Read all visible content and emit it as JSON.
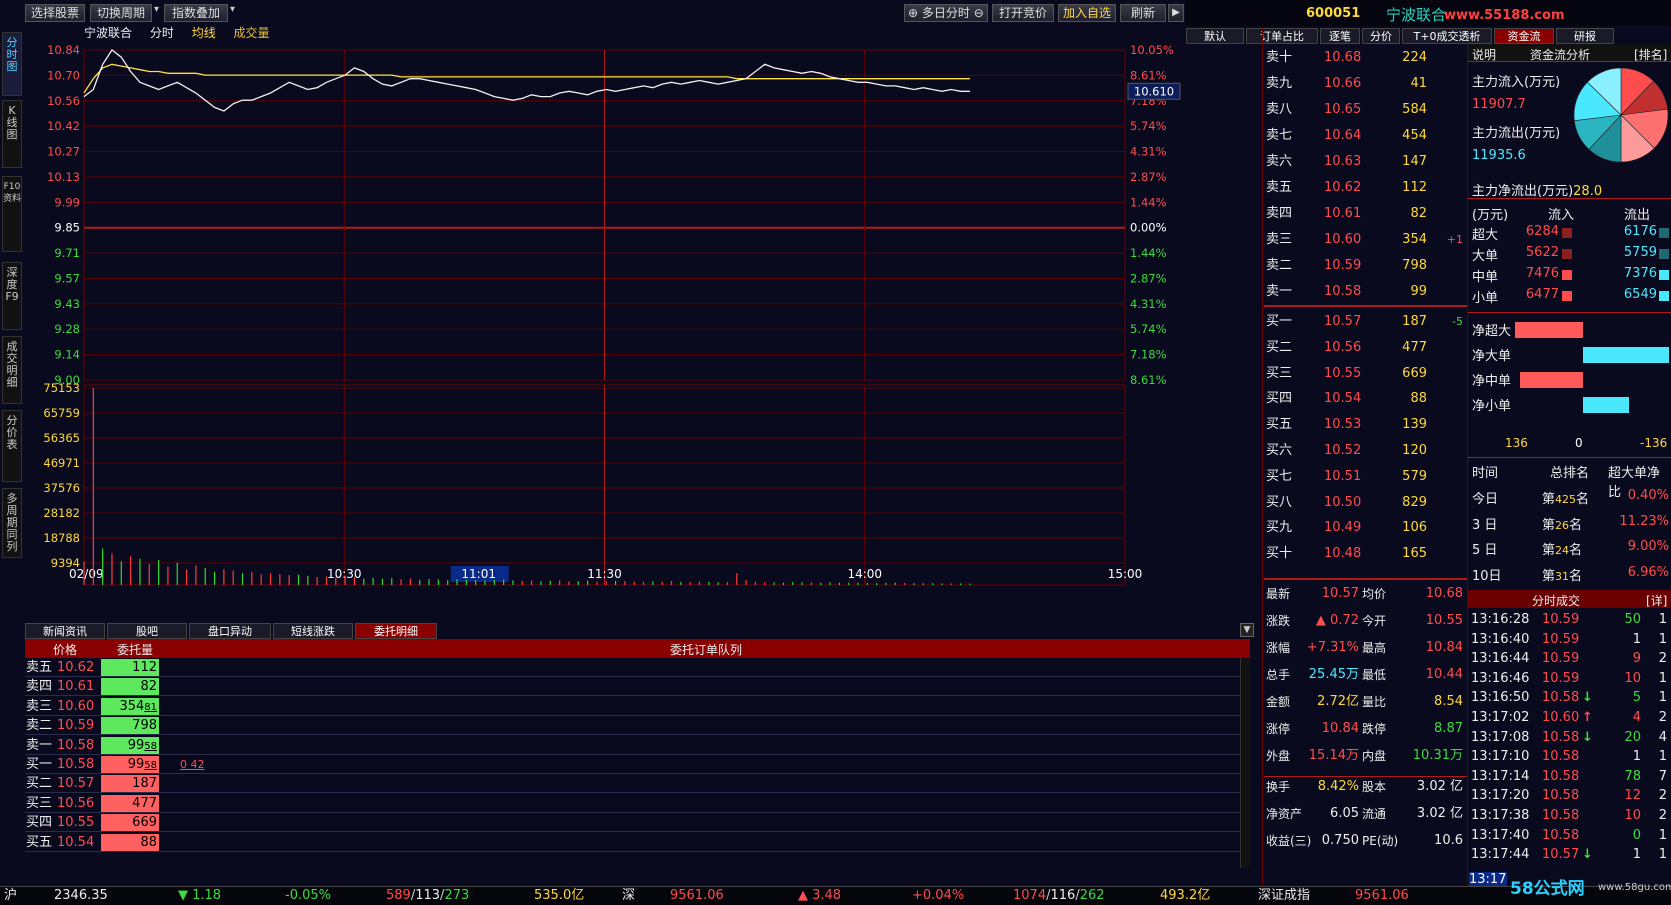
{
  "toolbar": {
    "select_stock": "选择股票",
    "switch_period": "切换周期",
    "index_overlay": "指数叠加",
    "multi_day": "多日分时",
    "open_auction": "打开竞价",
    "add_watch": "加入自选",
    "refresh": "刷新"
  },
  "stock": {
    "code": "600051",
    "name": "宁波联合",
    "watermark": "www.55188.com"
  },
  "side_tabs": [
    "分时图",
    "K线图",
    "F10资料",
    "深度F9",
    "成交明细",
    "分价表",
    "多周期同列"
  ],
  "chart_header": {
    "name": "宁波联合",
    "fenshi": "分时",
    "avg": "均线",
    "vol": "成交量"
  },
  "chart_data": {
    "type": "line",
    "price_ticks": [
      "10.84",
      "10.70",
      "10.56",
      "10.42",
      "10.27",
      "10.13",
      "9.99",
      "9.85",
      "9.71",
      "9.57",
      "9.43",
      "9.28",
      "9.14",
      "9.00"
    ],
    "pct_ticks": [
      "10.05%",
      "8.61%",
      "7.18%",
      "5.74%",
      "4.31%",
      "2.87%",
      "1.44%",
      "0.00%",
      "1.44%",
      "2.87%",
      "4.31%",
      "5.74%",
      "7.18%",
      "8.61%"
    ],
    "current_tag": "10.610",
    "prev_close": 9.85,
    "ylim": [
      9.0,
      10.84
    ],
    "time_labels": [
      "02/09",
      "10:30",
      "11:01",
      "11:30",
      "14:00",
      "15:00"
    ],
    "vol_ticks": [
      "75153",
      "65759",
      "56365",
      "46971",
      "37576",
      "28182",
      "18788",
      "9394"
    ],
    "vol_max": 75153,
    "price_series": [
      10.58,
      10.62,
      10.76,
      10.84,
      10.8,
      10.72,
      10.66,
      10.64,
      10.62,
      10.64,
      10.66,
      10.63,
      10.6,
      10.56,
      10.52,
      10.5,
      10.54,
      10.56,
      10.56,
      10.58,
      10.6,
      10.63,
      10.66,
      10.64,
      10.62,
      10.63,
      10.66,
      10.68,
      10.7,
      10.74,
      10.72,
      10.68,
      10.65,
      10.64,
      10.66,
      10.68,
      10.68,
      10.67,
      10.66,
      10.65,
      10.64,
      10.63,
      10.62,
      10.6,
      10.58,
      10.57,
      10.56,
      10.57,
      10.59,
      10.58,
      10.58,
      10.6,
      10.61,
      10.6,
      10.59,
      10.61,
      10.62,
      10.61,
      10.62,
      10.63,
      10.64,
      10.63,
      10.65,
      10.66,
      10.65,
      10.66,
      10.67,
      10.66,
      10.65,
      10.66,
      10.67,
      10.68,
      10.72,
      10.76,
      10.74,
      10.73,
      10.72,
      10.71,
      10.72,
      10.71,
      10.69,
      10.68,
      10.67,
      10.66,
      10.66,
      10.65,
      10.64,
      10.64,
      10.63,
      10.62,
      10.63,
      10.62,
      10.61,
      10.62,
      10.61,
      10.61
    ],
    "avg_series": [
      10.6,
      10.68,
      10.74,
      10.76,
      10.75,
      10.74,
      10.73,
      10.72,
      10.72,
      10.71,
      10.71,
      10.71,
      10.71,
      10.7,
      10.7,
      10.7,
      10.7,
      10.7,
      10.7,
      10.7,
      10.7,
      10.7,
      10.7,
      10.7,
      10.7,
      10.7,
      10.7,
      10.7,
      10.7,
      10.7,
      10.7,
      10.7,
      10.7,
      10.7,
      10.69,
      10.69,
      10.69,
      10.69,
      10.69,
      10.69,
      10.69,
      10.69,
      10.69,
      10.69,
      10.69,
      10.69,
      10.69,
      10.69,
      10.69,
      10.69,
      10.69,
      10.69,
      10.69,
      10.69,
      10.69,
      10.69,
      10.69,
      10.69,
      10.69,
      10.69,
      10.69,
      10.69,
      10.69,
      10.69,
      10.69,
      10.69,
      10.69,
      10.69,
      10.69,
      10.69,
      10.68,
      10.68,
      10.68,
      10.68,
      10.68,
      10.68,
      10.68,
      10.68,
      10.68,
      10.68,
      10.68,
      10.68,
      10.68,
      10.68,
      10.68,
      10.68,
      10.68,
      10.68,
      10.68,
      10.68,
      10.68,
      10.68,
      10.68,
      10.68,
      10.68,
      10.68
    ],
    "volumes": [
      9000,
      75153,
      14000,
      12000,
      9000,
      11000,
      10000,
      8000,
      9500,
      7000,
      8500,
      6000,
      7500,
      6500,
      5000,
      6000,
      5500,
      4500,
      5000,
      4000,
      4500,
      4200,
      3800,
      4000,
      3500,
      3000,
      3200,
      2800,
      3500,
      3000,
      2500,
      2700,
      2400,
      2600,
      2200,
      2500,
      2000,
      2300,
      2100,
      1900,
      2200,
      2000,
      1800,
      1700,
      1900,
      2100,
      1800,
      1600,
      1700,
      1500,
      1600,
      1800,
      1400,
      1500,
      1700,
      1300,
      1400,
      1600,
      1500,
      1300,
      1200,
      1400,
      1300,
      1500,
      1200,
      1100,
      1300,
      1200,
      1000,
      1100,
      4500,
      1900,
      1200,
      1100,
      1000,
      900,
      1100,
      1000,
      900,
      800,
      1000,
      900,
      850,
      900,
      800,
      700,
      900,
      800,
      750,
      700,
      650,
      700,
      600,
      650,
      600,
      550
    ],
    "vol_up": [
      true,
      true,
      false,
      true,
      false,
      true,
      false,
      true,
      false,
      true,
      false,
      true,
      true,
      false,
      false,
      true,
      true,
      false,
      true,
      true,
      true,
      true,
      true,
      false,
      false,
      true,
      true,
      true,
      true,
      true,
      false,
      false,
      false,
      false,
      true,
      true,
      false,
      false,
      false,
      false,
      false,
      false,
      false,
      false,
      false,
      false,
      false,
      true,
      true,
      false,
      false,
      true,
      true,
      false,
      false,
      true,
      true,
      false,
      true,
      true,
      true,
      false,
      true,
      true,
      false,
      true,
      true,
      false,
      false,
      true,
      true,
      true,
      true,
      true,
      false,
      false,
      false,
      false,
      true,
      false,
      false,
      false,
      false,
      false,
      false,
      false,
      false,
      false,
      true,
      false,
      false,
      false,
      false,
      true,
      false,
      false
    ]
  },
  "right_tabs": [
    "默认",
    "订单占比",
    "逐笔",
    "分价",
    "T+0成交透析",
    "资金流",
    "研报"
  ],
  "order_book": {
    "sells": [
      {
        "label": "卖十",
        "price": "10.68",
        "vol": "224",
        "chg": ""
      },
      {
        "label": "卖九",
        "price": "10.66",
        "vol": "41",
        "chg": ""
      },
      {
        "label": "卖八",
        "price": "10.65",
        "vol": "584",
        "chg": ""
      },
      {
        "label": "卖七",
        "price": "10.64",
        "vol": "454",
        "chg": ""
      },
      {
        "label": "卖六",
        "price": "10.63",
        "vol": "147",
        "chg": ""
      },
      {
        "label": "卖五",
        "price": "10.62",
        "vol": "112",
        "chg": ""
      },
      {
        "label": "卖四",
        "price": "10.61",
        "vol": "82",
        "chg": ""
      },
      {
        "label": "卖三",
        "price": "10.60",
        "vol": "354",
        "chg": "+1"
      },
      {
        "label": "卖二",
        "price": "10.59",
        "vol": "798",
        "chg": ""
      },
      {
        "label": "卖一",
        "price": "10.58",
        "vol": "99",
        "chg": ""
      }
    ],
    "buys": [
      {
        "label": "买一",
        "price": "10.57",
        "vol": "187",
        "chg": "-5"
      },
      {
        "label": "买二",
        "price": "10.56",
        "vol": "477",
        "chg": ""
      },
      {
        "label": "买三",
        "price": "10.55",
        "vol": "669",
        "chg": ""
      },
      {
        "label": "买四",
        "price": "10.54",
        "vol": "88",
        "chg": ""
      },
      {
        "label": "买五",
        "price": "10.53",
        "vol": "139",
        "chg": ""
      },
      {
        "label": "买六",
        "price": "10.52",
        "vol": "120",
        "chg": ""
      },
      {
        "label": "买七",
        "price": "10.51",
        "vol": "579",
        "chg": ""
      },
      {
        "label": "买八",
        "price": "10.50",
        "vol": "829",
        "chg": ""
      },
      {
        "label": "买九",
        "price": "10.49",
        "vol": "106",
        "chg": ""
      },
      {
        "label": "买十",
        "price": "10.48",
        "vol": "165",
        "chg": ""
      }
    ]
  },
  "quote": [
    {
      "l1": "最新",
      "v1": "10.57",
      "c1": "red",
      "l2": "均价",
      "v2": "10.68",
      "c2": "red"
    },
    {
      "l1": "涨跌",
      "v1": "▲ 0.72",
      "c1": "red",
      "l2": "今开",
      "v2": "10.55",
      "c2": "red"
    },
    {
      "l1": "涨幅",
      "v1": "+7.31%",
      "c1": "red",
      "l2": "最高",
      "v2": "10.84",
      "c2": "red"
    },
    {
      "l1": "总手",
      "v1": "25.45万",
      "c1": "cyan",
      "l2": "最低",
      "v2": "10.44",
      "c2": "red"
    },
    {
      "l1": "金额",
      "v1": "2.72亿",
      "c1": "yel",
      "l2": "量比",
      "v2": "8.54",
      "c2": "yel"
    },
    {
      "l1": "涨停",
      "v1": "10.84",
      "c1": "red",
      "l2": "跌停",
      "v2": "8.87",
      "c2": "grn"
    },
    {
      "l1": "外盘",
      "v1": "15.14万",
      "c1": "red",
      "l2": "内盘",
      "v2": "10.31万",
      "c2": "grn"
    },
    {
      "l1": "换手",
      "v1": "8.42%",
      "c1": "yel",
      "l2": "股本",
      "v2": "3.02 亿",
      "c2": "wht"
    },
    {
      "l1": "净资产",
      "v1": "6.05",
      "c1": "wht",
      "l2": "流通",
      "v2": "3.02 亿",
      "c2": "wht"
    },
    {
      "l1": "收益(三)",
      "v1": "0.750",
      "c1": "wht",
      "l2": "PE(动)",
      "v2": "10.6",
      "c2": "wht"
    }
  ],
  "fund_flow": {
    "header_explain": "说明",
    "header_title": "资金流分析",
    "header_rank": "[排名]",
    "inflow_label": "主力流入(万元)",
    "inflow": "11907.7",
    "outflow_label": "主力流出(万元)",
    "outflow": "11935.6",
    "net_label": "主力净流出(万元)",
    "net": "28.0",
    "col_unit": "(万元)",
    "col_in": "流入",
    "col_out": "流出",
    "rows": [
      {
        "label": "超大",
        "in": "6284",
        "out": "6176"
      },
      {
        "label": "大单",
        "in": "5622",
        "out": "5759"
      },
      {
        "label": "中单",
        "in": "7476",
        "out": "7376"
      },
      {
        "label": "小单",
        "in": "6477",
        "out": "6549"
      }
    ],
    "net_rows": [
      {
        "label": "净超大",
        "value": 108
      },
      {
        "label": "净大单",
        "value": -136
      },
      {
        "label": "净中单",
        "value": 100
      },
      {
        "label": "净小单",
        "value": -72
      }
    ],
    "axis": [
      "136",
      "0",
      "-136"
    ],
    "rank_header": [
      "时间",
      "总排名",
      "超大单净比"
    ],
    "ranks": [
      {
        "t": "今日",
        "pre": "第",
        "r": "425",
        "suf": "名",
        "p": "0.40%"
      },
      {
        "t": "3 日",
        "pre": "第",
        "r": "26",
        "suf": "名",
        "p": "11.23%"
      },
      {
        "t": "5 日",
        "pre": "第",
        "r": "24",
        "suf": "名",
        "p": "9.00%"
      },
      {
        "t": "10日",
        "pre": "第",
        "r": "31",
        "suf": "名",
        "p": "6.96%"
      }
    ],
    "colors": {
      "in": "#ff5a5a",
      "out": "#4ae8ff",
      "pie_red": "#ff4d4d",
      "pie_cyan": "#4ae8ff"
    }
  },
  "ticks": {
    "title": "分时成交",
    "detail": "[详]",
    "rows": [
      {
        "t": "13:16:28",
        "p": "10.59",
        "a": "",
        "v": "50",
        "n": "1",
        "vc": "grn"
      },
      {
        "t": "13:16:40",
        "p": "10.59",
        "a": "",
        "v": "1",
        "n": "1",
        "vc": "wht"
      },
      {
        "t": "13:16:44",
        "p": "10.59",
        "a": "",
        "v": "9",
        "n": "2",
        "vc": "red"
      },
      {
        "t": "13:16:46",
        "p": "10.59",
        "a": "",
        "v": "10",
        "n": "1",
        "vc": "red"
      },
      {
        "t": "13:16:50",
        "p": "10.58",
        "a": "↓",
        "v": "5",
        "n": "1",
        "vc": "grn"
      },
      {
        "t": "13:17:02",
        "p": "10.60",
        "a": "↑",
        "v": "4",
        "n": "2",
        "vc": "red"
      },
      {
        "t": "13:17:08",
        "p": "10.58",
        "a": "↓",
        "v": "20",
        "n": "4",
        "vc": "grn"
      },
      {
        "t": "13:17:10",
        "p": "10.58",
        "a": "",
        "v": "1",
        "n": "1",
        "vc": "wht"
      },
      {
        "t": "13:17:14",
        "p": "10.58",
        "a": "",
        "v": "78",
        "n": "7",
        "vc": "grn"
      },
      {
        "t": "13:17:20",
        "p": "10.58",
        "a": "",
        "v": "12",
        "n": "2",
        "vc": "red"
      },
      {
        "t": "13:17:38",
        "p": "10.58",
        "a": "",
        "v": "10",
        "n": "2",
        "vc": "red"
      },
      {
        "t": "13:17:40",
        "p": "10.58",
        "a": "",
        "v": "0",
        "n": "1",
        "vc": "grn"
      },
      {
        "t": "13:17:44",
        "p": "10.57",
        "a": "↓",
        "v": "1",
        "n": "1",
        "vc": "wht"
      }
    ],
    "cut_time": "13:17"
  },
  "bottom_tabs": [
    "新闻资讯",
    "股吧",
    "盘口异动",
    "短线涨跌",
    "委托明细"
  ],
  "order_queue": {
    "h_price": "价格",
    "h_vol": "委托量",
    "h_queue": "委托订单队列",
    "rows": [
      {
        "l": "卖五",
        "p": "10.62",
        "v": "112",
        "side": "s",
        "bar": "",
        "q": ""
      },
      {
        "l": "卖四",
        "p": "10.61",
        "v": "82",
        "side": "s",
        "bar": "",
        "q": ""
      },
      {
        "l": "卖三",
        "p": "10.60",
        "v": "354",
        "side": "s",
        "bar": "81",
        "q": ""
      },
      {
        "l": "卖二",
        "p": "10.59",
        "v": "798",
        "side": "s",
        "bar": "",
        "q": ""
      },
      {
        "l": "卖一",
        "p": "10.58",
        "v": "99",
        "side": "s",
        "bar": "58",
        "q": ""
      },
      {
        "l": "买一",
        "p": "10.58",
        "v": "99",
        "side": "b",
        "bar": "58",
        "q": "0 42"
      },
      {
        "l": "买二",
        "p": "10.57",
        "v": "187",
        "side": "b",
        "bar": "",
        "q": ""
      },
      {
        "l": "买三",
        "p": "10.56",
        "v": "477",
        "side": "b",
        "bar": "",
        "q": ""
      },
      {
        "l": "买四",
        "p": "10.55",
        "v": "669",
        "side": "b",
        "bar": "",
        "q": ""
      },
      {
        "l": "买五",
        "p": "10.54",
        "v": "88",
        "side": "b",
        "bar": "",
        "q": ""
      }
    ]
  },
  "status_bar": {
    "sh": "沪",
    "sh_idx": "2346.35",
    "sh_chg": "▼ 1.18",
    "sh_pct": "-0.05%",
    "sh_ud1": "589",
    "sh_ud2": "113",
    "sh_ud3": "273",
    "sh_amt": "535.0亿",
    "sz": "深",
    "sz_idx": "9561.06",
    "sz_chg": "▲ 3.48",
    "sz_pct": "+0.04%",
    "sz_ud1": "1074",
    "sz_ud2": "116",
    "sz_ud3": "262",
    "sz_amt": "493.2亿",
    "sz_name": "深证成指",
    "sz_idx2": "9561.06",
    "site": "58公式网",
    "site_url": "www.58gu.com"
  }
}
